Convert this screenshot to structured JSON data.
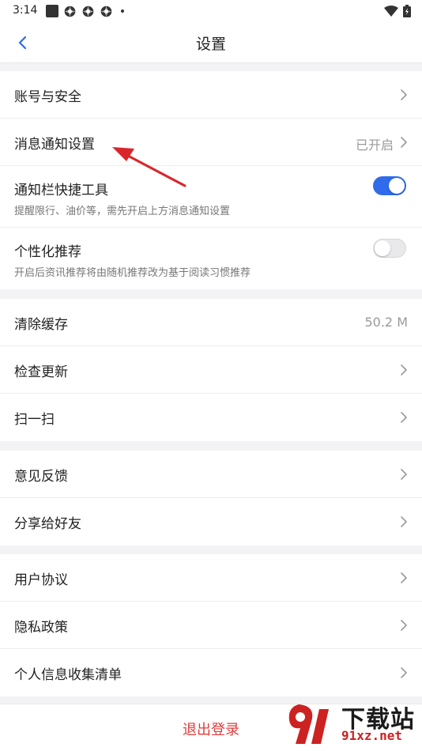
{
  "status_bar": {
    "time": "3:14"
  },
  "header": {
    "title": "设置"
  },
  "section1": {
    "account_security": {
      "label": "账号与安全"
    },
    "notification_settings": {
      "label": "消息通知设置",
      "value": "已开启"
    },
    "quick_tools": {
      "label": "通知栏快捷工具",
      "subtitle": "提醒限行、油价等，需先开启上方消息通知设置",
      "enabled": true
    },
    "personalized": {
      "label": "个性化推荐",
      "subtitle": "开启后资讯推荐将由随机推荐改为基于阅读习惯推荐",
      "enabled": false
    }
  },
  "section2": {
    "clear_cache": {
      "label": "清除缓存",
      "value": "50.2 M"
    },
    "check_update": {
      "label": "检查更新"
    },
    "scan": {
      "label": "扫一扫"
    }
  },
  "section3": {
    "feedback": {
      "label": "意见反馈"
    },
    "share": {
      "label": "分享给好友"
    }
  },
  "section4": {
    "user_agreement": {
      "label": "用户协议"
    },
    "privacy_policy": {
      "label": "隐私政策"
    },
    "personal_info": {
      "label": "个人信息收集清单"
    }
  },
  "logout": {
    "label": "退出登录"
  },
  "watermark": {
    "text": "下载站",
    "domain": "91xz.net"
  },
  "colors": {
    "accent": "#2f6bea",
    "danger": "#e23b3b",
    "annotation": "#d9262b"
  }
}
